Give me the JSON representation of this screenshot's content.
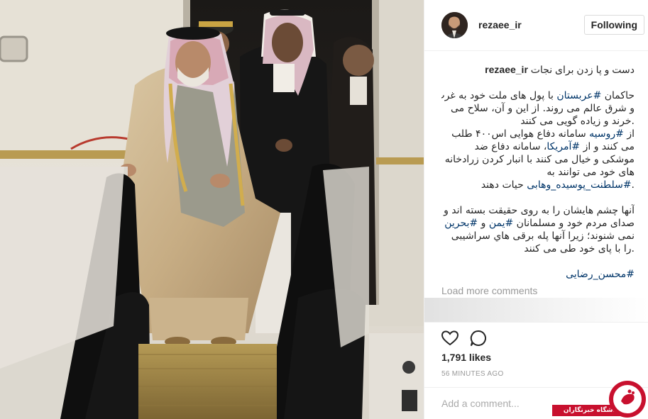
{
  "post": {
    "username": "rezaee_ir",
    "follow_label": "Following",
    "caption_title": "دست و پا زدن برای نجات",
    "caption_lines_p1": [
      "حاکمان #عربستان با پول های ملت خود به غرب",
      "و شرق عالم می روند. از این و آن، سلاح می",
      ".خرند و زیاده گویی می کنند"
    ],
    "caption_lines_p2": [
      "از #روسیه سامانه دفاع هوایی اس۴۰۰ طلب",
      "می کنند و از #آمریکا، سامانه دفاع ضد",
      "موشکی و خیال می کنند با انبار کردن زرادخانه",
      "های خود می توانند به",
      ".#سلطنت_پوسیده_وهابی حیات دهند"
    ],
    "caption_lines_p3": [
      "آنها چشم هایشان را به روی حقیقت بسته اند و",
      "صدای مردم خود و مسلمانان #یمن و #بحرین را",
      "نمی شنوند؛ زیرا آنها پله برقی هاي سراشیبی",
      ".را با پای خود طی می کنند"
    ],
    "signature_tag": "#محسن_رضایی",
    "load_more": "Load more comments",
    "likes": "1,791 likes",
    "timestamp": "56 MINUTES AGO",
    "comment_placeholder": "Add a comment...",
    "icons": {
      "like": "heart-icon",
      "comment": "speech-bubble-icon",
      "more": "ellipsis-icon"
    }
  },
  "watermark": {
    "text": "باشگاه خبرنگاران"
  },
  "colors": {
    "hashtag": "#003569",
    "muted": "#999999",
    "border": "#efefef",
    "watermark_red": "#c8102e"
  }
}
